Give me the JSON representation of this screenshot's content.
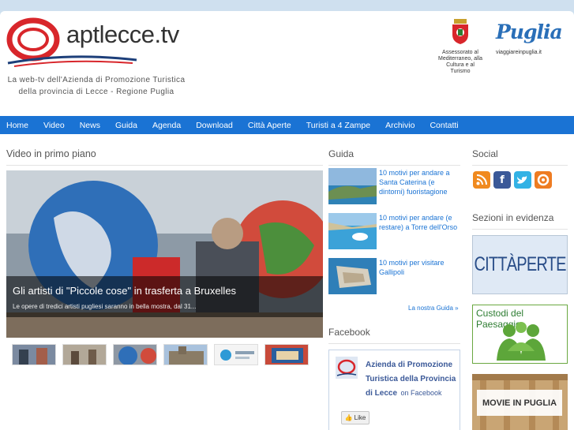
{
  "header": {
    "title": "aptlecce.tv",
    "tagline": "La web-tv dell'Azienda di Promozione Turistica della provincia di Lecce - Regione Puglia",
    "assessorato": "Assessorato al Mediterraneo, alla Cultura e al Turismo",
    "puglia_logo": "Puglia",
    "puglia_url": "viaggiareinpuglia.it"
  },
  "nav": {
    "items": [
      "Home",
      "Video",
      "News",
      "Guida",
      "Agenda",
      "Download",
      "Città Aperte",
      "Turisti a 4 Zampe",
      "Archivio",
      "Contatti"
    ]
  },
  "video": {
    "section_title": "Video in primo piano",
    "featured_title": "Gli artisti di \"Piccole cose\" in trasferta a Bruxelles",
    "featured_desc": "Le opere di tredici artisti pugliesi saranno in bella mostra, dal 31..."
  },
  "guida": {
    "section_title": "Guida",
    "items": [
      "10 motivi per andare a Santa Caterina (e dintorni) fuoristagione",
      "10 motivi per andare (e restare) a Torre dell'Orso",
      "10 motivi per visitare Gallipoli"
    ],
    "more": "La nostra Guida »"
  },
  "facebook": {
    "section_title": "Facebook",
    "page_name": "Azienda di Promozione Turistica della Provincia di Lecce",
    "on_facebook": "on Facebook",
    "like": "Like"
  },
  "social": {
    "section_title": "Social",
    "icons": [
      "rss-icon",
      "facebook-icon",
      "twitter-icon",
      "other-icon"
    ]
  },
  "sezioni": {
    "section_title": "Sezioni in evidenza",
    "citta": "CITTÀPERTE",
    "custodi": "Custodi del Paesaggio",
    "movie": "MOVIE IN PUGLIA"
  },
  "colors": {
    "nav": "#1a73d4",
    "link": "#1a73d4"
  }
}
